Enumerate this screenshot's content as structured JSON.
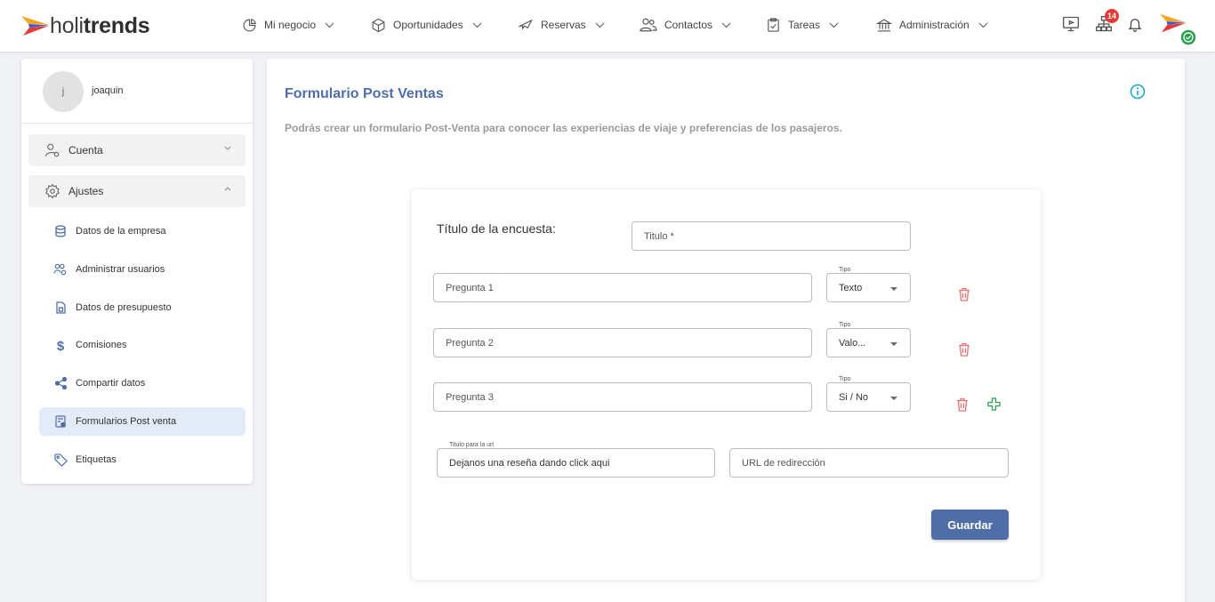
{
  "topbar": {
    "brand_light": "holi",
    "brand_bold": "trends",
    "nav": [
      {
        "label": "Mi negocio",
        "icon": "pie-chart-icon"
      },
      {
        "label": "Oportunidades",
        "icon": "box-icon"
      },
      {
        "label": "Reservas",
        "icon": "plane-icon"
      },
      {
        "label": "Contactos",
        "icon": "users-icon"
      },
      {
        "label": "Tareas",
        "icon": "clipboard-icon"
      },
      {
        "label": "Administración",
        "icon": "bank-icon"
      }
    ],
    "notifications_badge": "14"
  },
  "sidebar": {
    "avatar_initial": "j",
    "username": "joaquin",
    "groups": [
      {
        "label": "Cuenta",
        "icon": "user-gear-icon"
      },
      {
        "label": "Ajustes",
        "icon": "gear-icon"
      }
    ],
    "items": [
      {
        "label": "Datos de la empresa",
        "icon": "database-icon"
      },
      {
        "label": "Administrar usuarios",
        "icon": "users-gear-icon"
      },
      {
        "label": "Datos de presupuesto",
        "icon": "document-icon"
      },
      {
        "label": "Comisiones",
        "icon": "dollar-icon"
      },
      {
        "label": "Compartir datos",
        "icon": "share-icon"
      },
      {
        "label": "Formularios Post venta",
        "icon": "form-icon",
        "active": true
      },
      {
        "label": "Etiquetas",
        "icon": "tag-icon"
      }
    ]
  },
  "main": {
    "title": "Formulario Post Ventas",
    "subtitle": "Podrás crear un formulario Post-Venta para conocer las experiencias de viaje y preferencias de los pasajeros.",
    "form": {
      "survey_title_label": "Título de la encuesta:",
      "survey_title_placeholder": "Titulo *",
      "questions": [
        {
          "placeholder": "Pregunta 1",
          "type_label": "Tipo",
          "type_value": "Texto"
        },
        {
          "placeholder": "Pregunta 2",
          "type_label": "Tipo",
          "type_value": "Valo..."
        },
        {
          "placeholder": "Pregunta 3",
          "type_label": "Tipo",
          "type_value": "Si / No"
        }
      ],
      "url_title_label": "Titulo para la url",
      "url_title_value": "Dejanos una reseña dando click aqui",
      "redirect_url_placeholder": "URL de redirección",
      "save_label": "Guardar"
    }
  },
  "colors": {
    "accent": "#4f6ea8",
    "delete": "#e57373",
    "add": "#2e9e4f",
    "badge": "#e53935",
    "info": "#1aa7c7"
  }
}
